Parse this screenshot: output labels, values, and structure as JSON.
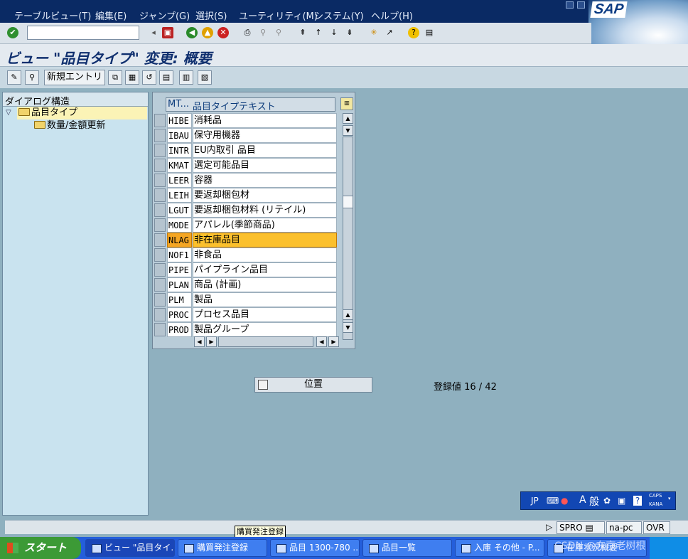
{
  "menu": {
    "items": [
      "テーブルビュー(T)",
      "編集(E)",
      "ジャンプ(G)",
      "選択(S)",
      "ユーティリティ(M)",
      "システム(Y)",
      "ヘルプ(H)"
    ]
  },
  "brand": "SAP",
  "title": "ビュー \"品目タイプ\" 変更: 概要",
  "app_toolbar": {
    "new_entries": "新規エントリ"
  },
  "tree": {
    "header": "ダイアログ構造",
    "nodes": [
      "品目タイプ",
      "数量/金額更新"
    ]
  },
  "table": {
    "col_code": "MT...",
    "col_text": "品目タイプテキスト",
    "rows": [
      {
        "code": "HIBE",
        "text": "消耗品"
      },
      {
        "code": "IBAU",
        "text": "保守用機器"
      },
      {
        "code": "INTR",
        "text": "EU内取引 品目"
      },
      {
        "code": "KMAT",
        "text": "選定可能品目"
      },
      {
        "code": "LEER",
        "text": "容器"
      },
      {
        "code": "LEIH",
        "text": "要返却梱包材"
      },
      {
        "code": "LGUT",
        "text": "要返却梱包材料 (リテイル)"
      },
      {
        "code": "MODE",
        "text": "アパレル(季節商品)"
      },
      {
        "code": "NLAG",
        "text": "非在庫品目"
      },
      {
        "code": "NOF1",
        "text": "非食品"
      },
      {
        "code": "PIPE",
        "text": "パイプライン品目"
      },
      {
        "code": "PLAN",
        "text": "商品 (計画)"
      },
      {
        "code": "PLM",
        "text": "製品"
      },
      {
        "code": "PROC",
        "text": "プロセス品目"
      },
      {
        "code": "PROD",
        "text": "製品グループ"
      }
    ]
  },
  "position_button": "位置",
  "entry_count": "登録値 16 / 42",
  "ime": {
    "jp": "JP",
    "a": "A",
    "ippan": "般",
    "caps": "CAPS",
    "kana": "KANA"
  },
  "status": {
    "tcode": "SPRO",
    "host": "na-pc",
    "mode": "OVR"
  },
  "tooltip": "購買発注登録",
  "taskbar": {
    "start": "スタート",
    "tasks": [
      "ビュー \"品目タイ...",
      "購買発注登録",
      "品目 1300-780 ...",
      "品目一覧",
      "入庫 その他 - P...",
      "在庫状況概要"
    ]
  },
  "watermark": "CSDN @东京老树根"
}
